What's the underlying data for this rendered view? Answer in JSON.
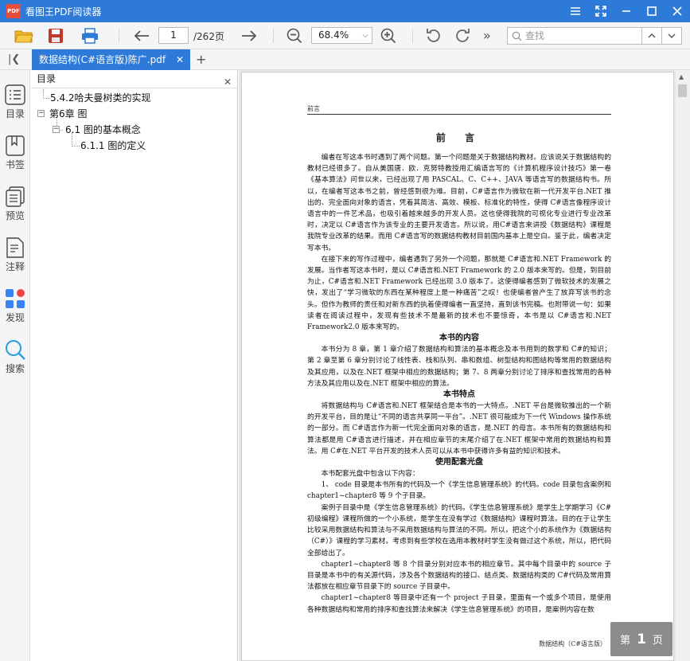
{
  "window": {
    "app_title": "看图王PDF阅读器",
    "logo_text": "PDF"
  },
  "toolbar": {
    "page_current": "1",
    "page_total": "/262页",
    "zoom": "68.4%",
    "search_placeholder": "查找"
  },
  "tabs": [
    {
      "label": "数据结构(C#语言版)陈广.pdf"
    }
  ],
  "rail": [
    {
      "label": "目录",
      "icon": "list-icon"
    },
    {
      "label": "书签",
      "icon": "bookmark-icon"
    },
    {
      "label": "预览",
      "icon": "pages-icon"
    },
    {
      "label": "注释",
      "icon": "note-icon"
    },
    {
      "label": "发现",
      "icon": "apps-icon"
    },
    {
      "label": "搜索",
      "icon": "search-icon"
    }
  ],
  "outline": {
    "title": "目录",
    "items": [
      {
        "label": "5.4.2哈夫曼树类的实现"
      },
      {
        "label": "第6章 图"
      },
      {
        "label": "6.1 图的基本概念"
      },
      {
        "label": "6.1.1 图的定义"
      }
    ]
  },
  "document": {
    "running_head": "前言",
    "title": "前 言",
    "paragraphs": [
      {
        "type": "p",
        "text": "编者在写这本书时遇到了两个问题。第一个问题是关于数据结构教材。应该说关于数据结构的教材已经很多了。自从美国唐．欧．克努特教授用汇编语言写的《计算机程序设计技巧》第一卷《基本算法》问世以来，已经出现了用 PASCAL、C、C++、JAVA 等语言写的数据结构书。所以，在编者写这本书之前，曾经感到很为难。目前，C#语言作为微软在新一代开发平台.NET 推出的、完全面向对象的语言，凭着其简洁、高效、模板、标准化的特性，使得 C#语言像程序设计语言中的一件艺术品，也吸引着越来越多的开发人员。这也使得我院的可视化专业进行专业改革时，决定以 C#语言作为该专业的主要开发语言。所以说，用C#语言来讲授《数据结构》课程是我院专业改革的结果。而用 C#语言写的数据结构教材目前国内基本上是空白。鉴于此，编者决定写本书。"
      },
      {
        "type": "p",
        "text": "在接下来的写作过程中，编者遇到了另外一个问题，那就是 C#语言和.NET Framework 的发展。当作者写这本书时，是以 C#语言和.NET Framework 的 2.0 版本来写的。但是，到目前为止，C#语言和.NET Framework 已经出现 3.0 版本了。这使得编者感到了微软技术的发展之快，发出了“学习微软的东西在某种程度上是一种痛苦”之叹！也使编者曾产生了放弃写该书的念头。但作为教师的责任和对新东西的执着使得编者一直坚持，直到该书完稿。也附带说一句：如果读者在阅读过程中，发现有些技术不是最新的技术也不要惊奇，本书是以 C#语言和.NET Framework2.0 版本来写的。"
      },
      {
        "type": "h",
        "text": "本书的内容"
      },
      {
        "type": "p",
        "text": "本书分为 8 章，第 1 章介绍了数据结构和算法的基本概念及本书用到的数学和 C#的知识；第 2 章至第 6 章分别讨论了线性表、栈和队列、串和数组、树型结构和图结构等常用的数据结构及其应用，以及在.NET 框架中相应的数据结构；第 7、8 两章分别讨论了排序和查找常用的各种方法及其应用以及在.NET 框架中相应的算法。"
      },
      {
        "type": "h",
        "text": "本书特点"
      },
      {
        "type": "p",
        "text": "将数据结构与 C#语言和.NET 框架结合是本书的一大特点。.NET 平台是微软推出的一个新的开发平台，目的是让“不同的语言共享同一平台”。.NET 很可能成为下一代 Windows 操作系统的一部分。而 C#语言作为新一代完全面向对象的语言，是.NET 的母言。本书所有的数据结构和算法都是用 C#语言进行描述，并在相应章节的末尾介绍了在.NET 框架中常用的数据结构和算法。用 C#在.NET 平台开发的技术人员可以从本书中获得许多有益的知识和技术。"
      },
      {
        "type": "h",
        "text": "使用配套光盘"
      },
      {
        "type": "p",
        "text": "本书配套光盘中包含以下内容："
      },
      {
        "type": "p",
        "text": "1、 code 目录是本书所有的代码及一个《学生信息管理系统》的代码。code 目录包含案例和 chapter1~chapter8 等 9 个子目录。"
      },
      {
        "type": "p",
        "text": "案例子目录中是《学生信息管理系统》的代码。《学生信息管理系统》是学生上学期学习《C#初级编程》课程所做的一个小系统，是学生在没有学过《数据结构》课程时算法。目的在于让学生比较采用数据结构和算法与不采用数据结构与算法的不同。所以，把这个小的系统作为《数据结构（C#）》课程的学习素材。考虑到有些学校在选用本教材时学生没有做过这个系统，所以，把代码全部给出了。"
      },
      {
        "type": "p",
        "text": "chapter1~chapter8 等 8 个目录分别对应本书的相应章节。其中每个目录中的 source 子目录是本书中的有关源代码，涉及各个数据结构的接口、结点类、数据结构类的 C#代码及常用算法都放在相应章节目录下的 source 子目录中。"
      },
      {
        "type": "p",
        "text": "chapter1~chapter8 等目录中还有一个 project 子目录，里面有一个或多个项目，是使用各种数据结构和常用的排序和查找算法来解决《学生信息管理系统》的项目，是案例内容在数"
      }
    ],
    "running_foot": "数据结构（C#语言版）"
  },
  "page_badge": {
    "prefix": "第",
    "number": "1",
    "suffix": "页"
  },
  "colors": {
    "accent": "#2d7ad8"
  }
}
